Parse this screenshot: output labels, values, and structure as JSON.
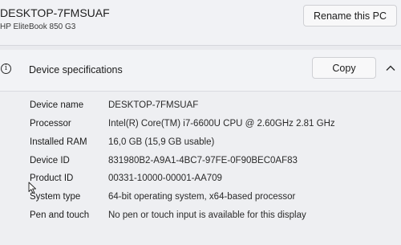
{
  "device": {
    "name": "DESKTOP-7FMSUAF",
    "model": "HP EliteBook 850 G3",
    "rename_label": "Rename this PC"
  },
  "specifications": {
    "icon": "info-icon",
    "title": "Device specifications",
    "copy_label": "Copy",
    "collapse_icon": "chevron-up-icon",
    "rows": [
      {
        "label": "Device name",
        "value": "DESKTOP-7FMSUAF"
      },
      {
        "label": "Processor",
        "value": "Intel(R) Core(TM) i7-6600U CPU @ 2.60GHz   2.81 GHz"
      },
      {
        "label": "Installed RAM",
        "value": "16,0 GB (15,9 GB usable)"
      },
      {
        "label": "Device ID",
        "value": "831980B2-A9A1-4BC7-97FE-0F90BEC0AF83"
      },
      {
        "label": "Product ID",
        "value": "00331-10000-00001-AA709"
      },
      {
        "label": "System type",
        "value": "64-bit operating system, x64-based processor"
      },
      {
        "label": "Pen and touch",
        "value": "No pen or touch input is available for this display"
      }
    ]
  },
  "colors": {
    "page_background": "#e9eaee",
    "card_background": "#f1f2f5",
    "text": "#1b1b1b"
  }
}
